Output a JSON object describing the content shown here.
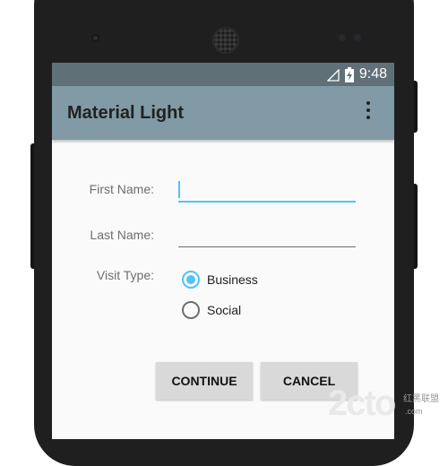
{
  "status_bar": {
    "time": "9:48"
  },
  "app_bar": {
    "title": "Material Light"
  },
  "form": {
    "first_name_label": "First Name:",
    "first_name_value": "",
    "last_name_label": "Last Name:",
    "last_name_value": "",
    "visit_type_label": "Visit Type:",
    "visit_type_options": [
      {
        "label": "Business",
        "selected": true
      },
      {
        "label": "Social",
        "selected": false
      }
    ]
  },
  "buttons": {
    "continue": "CONTINUE",
    "cancel": "CANCEL"
  },
  "watermark": {
    "brand": "2cto",
    "cn": "红黑联盟",
    "url": ".com"
  },
  "colors": {
    "status_bar": "#5f7079",
    "app_bar": "#819aa5",
    "accent": "#4fc3f7",
    "button": "#d9d9d9"
  }
}
